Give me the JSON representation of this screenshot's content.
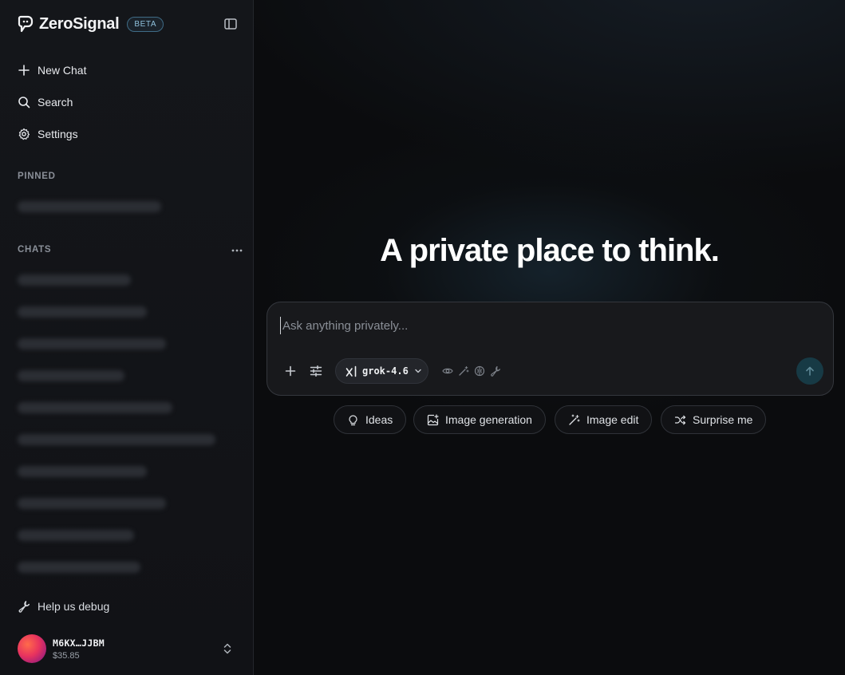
{
  "brand": {
    "name": "ZeroSignal",
    "badge": "BETA"
  },
  "nav": [
    {
      "label": "New Chat",
      "icon": "plus-icon"
    },
    {
      "label": "Search",
      "icon": "search-icon"
    },
    {
      "label": "Settings",
      "icon": "gear-icon"
    }
  ],
  "sections": {
    "pinned": "PINNED",
    "chats": "CHATS"
  },
  "footer": {
    "help": "Help us debug"
  },
  "account": {
    "id": "M6KX…JJBM",
    "balance": "$35.85"
  },
  "main": {
    "hero": "A private place to think.",
    "composer": {
      "placeholder": "Ask anything privately...",
      "model": "grok-4.6"
    },
    "chips": [
      {
        "label": "Ideas",
        "icon": "lightbulb-icon"
      },
      {
        "label": "Image generation",
        "icon": "image-plus-icon"
      },
      {
        "label": "Image edit",
        "icon": "magic-wand-icon"
      },
      {
        "label": "Surprise me",
        "icon": "shuffle-icon"
      }
    ]
  },
  "colors": {
    "accent": "#173a45",
    "badge": "#8fc1dc",
    "background": "#0b0c0e"
  }
}
